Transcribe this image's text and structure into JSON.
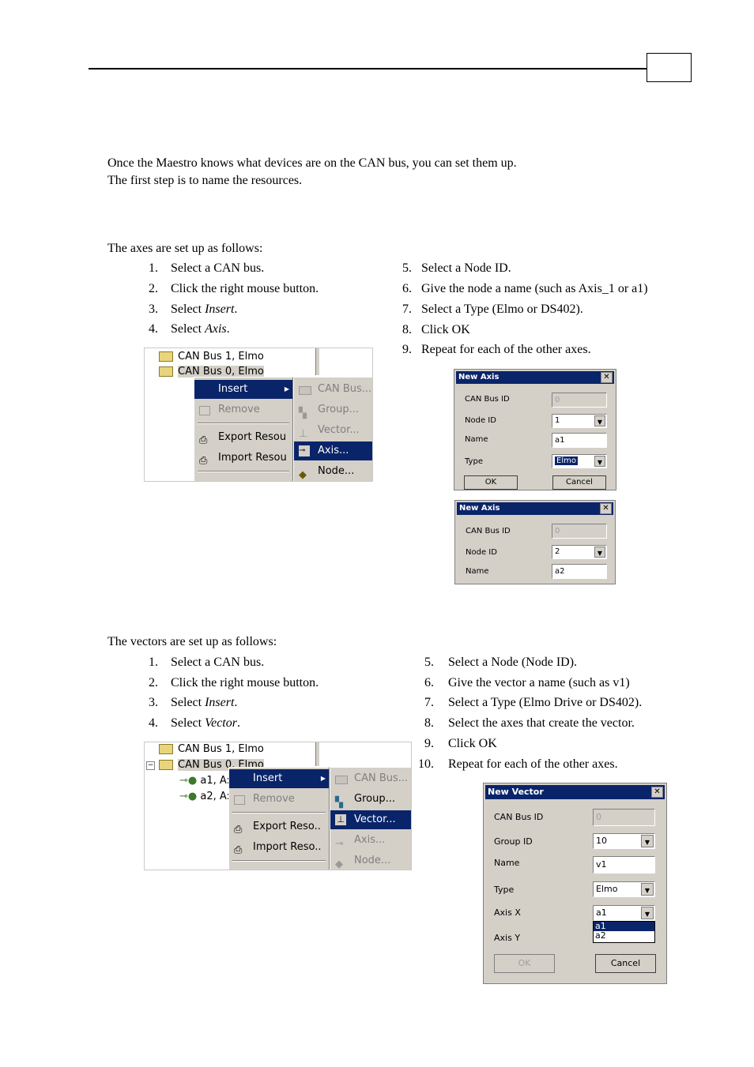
{
  "intro": {
    "line1": "Once the Maestro knows what devices are on the CAN bus, you can set them up.",
    "line2": "The first step is to name the resources."
  },
  "axes": {
    "heading": "The axes are set up as follows:",
    "steps_left": [
      {
        "num": "1.",
        "text": "Select a CAN bus."
      },
      {
        "num": "2.",
        "text": "Click the right mouse button."
      },
      {
        "num": "3.",
        "text_pre": "Select ",
        "text_em": "Insert",
        "text_post": "."
      },
      {
        "num": "4.",
        "text_pre": "Select ",
        "text_em": "Axis",
        "text_post": "."
      }
    ],
    "steps_right": [
      {
        "num": "5.",
        "text": "Select a Node  ID."
      },
      {
        "num": "6.",
        "text": "Give the node a name (such as Axis_1 or a1)"
      },
      {
        "num": "7.",
        "text": "Select a Type (Elmo or DS402)."
      },
      {
        "num": "8.",
        "text": "Click OK"
      },
      {
        "num": "9.",
        "text": "Repeat for each of the other axes."
      }
    ],
    "screenshot": {
      "tree": [
        "CAN Bus 1, Elmo",
        "CAN Bus 0, Elmo"
      ],
      "context_menu": [
        "Insert",
        "Remove",
        "Export Resou",
        "Import Resou",
        "...."
      ],
      "submenu": [
        "CAN Bus...",
        "Group...",
        "Vector...",
        "Axis...",
        "Node..."
      ]
    },
    "dialog1": {
      "title": "New Axis",
      "close": "✕",
      "labels": {
        "canbus": "CAN Bus ID",
        "node": "Node ID",
        "name": "Name",
        "type": "Type"
      },
      "values": {
        "canbus": "0",
        "node": "1",
        "name": "a1",
        "type": "Elmo"
      },
      "ok": "OK",
      "cancel": "Cancel"
    },
    "dialog2": {
      "title": "New Axis",
      "close": "✕",
      "labels": {
        "canbus": "CAN Bus ID",
        "node": "Node ID",
        "name": "Name"
      },
      "values": {
        "canbus": "0",
        "node": "2",
        "name": "a2"
      }
    }
  },
  "vectors": {
    "heading": "The vectors are set up as follows:",
    "steps_left": [
      {
        "num": "1.",
        "text": "Select a CAN bus."
      },
      {
        "num": "2.",
        "text": "Click the right mouse button."
      },
      {
        "num": "3.",
        "text_pre": "Select ",
        "text_em": "Insert",
        "text_post": "."
      },
      {
        "num": "4.",
        "text_pre": "Select ",
        "text_em": "Vector",
        "text_post": "."
      }
    ],
    "steps_right": [
      {
        "num": "5.",
        "text": "Select a Node (Node ID)."
      },
      {
        "num": "6.",
        "text": "Give the vector a name (such as v1)"
      },
      {
        "num": "7.",
        "text": "Select a Type (Elmo Drive or DS402)."
      },
      {
        "num": "8.",
        "text": "Select the axes that create the vector."
      },
      {
        "num": "9.",
        "text": "Click OK"
      },
      {
        "num": "10.",
        "text": "Repeat for each of the other axes."
      }
    ],
    "screenshot": {
      "tree": [
        "CAN Bus 1, Elmo",
        "CAN Bus 0, Elmo",
        "a1, A:",
        "a2, A:"
      ],
      "context_menu": [
        "Insert",
        "Remove",
        "Export Reso..",
        "Import Reso..",
        "...."
      ],
      "submenu": [
        "CAN Bus...",
        "Group...",
        "Vector...",
        "Axis...",
        "Node..."
      ]
    },
    "dialog": {
      "title": "New Vector",
      "close": "✕",
      "labels": {
        "canbus": "CAN Bus ID",
        "group": "Group ID",
        "name": "Name",
        "type": "Type",
        "axisx": "Axis X",
        "axisy": "Axis Y"
      },
      "values": {
        "canbus": "0",
        "group": "10",
        "name": "v1",
        "type": "Elmo",
        "axisx": "a1"
      },
      "axis_options": [
        "a1",
        "a2"
      ],
      "ok": "OK",
      "cancel": "Cancel"
    }
  }
}
